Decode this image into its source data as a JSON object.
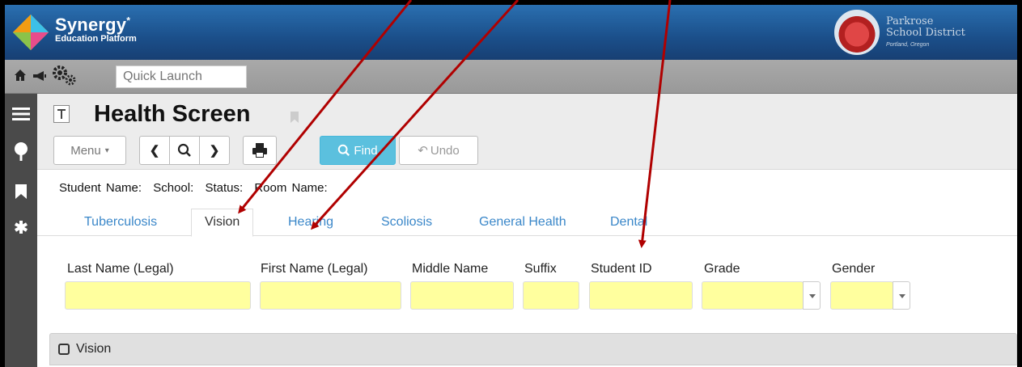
{
  "app": {
    "brand_name": "Synergy",
    "brand_mark": "*",
    "brand_sub": "Education Platform",
    "district_name_line1": "Parkrose",
    "district_name_line2": "School District",
    "district_location": "Portland, Oregon"
  },
  "quick_launch": {
    "placeholder": "Quick Launch"
  },
  "page": {
    "title": "Health Screen"
  },
  "toolbar": {
    "menu_label": "Menu",
    "find_label": "Find",
    "undo_label": "Undo"
  },
  "student": {
    "name_label": "Student Name:",
    "school_label": "School:",
    "status_label": "Status:",
    "room_label": "Room Name:"
  },
  "tabs": [
    {
      "label": "Tuberculosis"
    },
    {
      "label": "Vision",
      "active": true
    },
    {
      "label": "Hearing"
    },
    {
      "label": "Scoliosis"
    },
    {
      "label": "General Health"
    },
    {
      "label": "Dental"
    }
  ],
  "fields": [
    {
      "label": "Last Name (Legal)",
      "value": ""
    },
    {
      "label": "First Name (Legal)",
      "value": ""
    },
    {
      "label": "Middle Name",
      "value": ""
    },
    {
      "label": "Suffix",
      "value": ""
    },
    {
      "label": "Student ID",
      "value": ""
    },
    {
      "label": "Grade",
      "value": ""
    },
    {
      "label": "Gender",
      "value": ""
    }
  ],
  "section": {
    "title": "Vision"
  },
  "colors": {
    "header_blue": "#1b4f8a",
    "field_yellow": "#ffff9e",
    "find_button": "#5bc0de",
    "tab_link": "#3a87c9",
    "annotation_arrow": "#b00000"
  }
}
